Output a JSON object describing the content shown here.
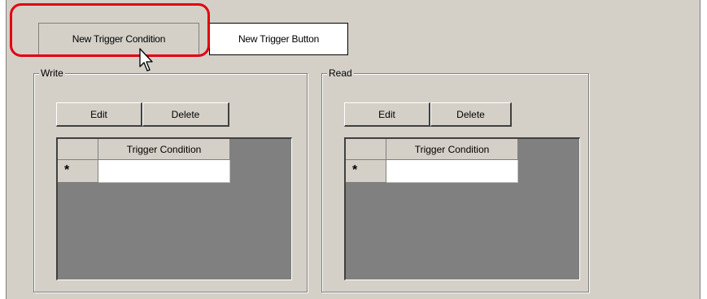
{
  "tabs": {
    "new_trigger_condition": "New Trigger Condition",
    "new_trigger_button": "New Trigger Button"
  },
  "write": {
    "title": "Write",
    "edit_label": "Edit",
    "delete_label": "Delete",
    "column_header": "Trigger Condition",
    "new_row_marker": "*"
  },
  "read": {
    "title": "Read",
    "edit_label": "Edit",
    "delete_label": "Delete",
    "column_header": "Trigger Condition",
    "new_row_marker": "*"
  },
  "colors": {
    "highlight": "#e3000f",
    "panel": "#d4d0c8",
    "grid_background": "#808080"
  }
}
